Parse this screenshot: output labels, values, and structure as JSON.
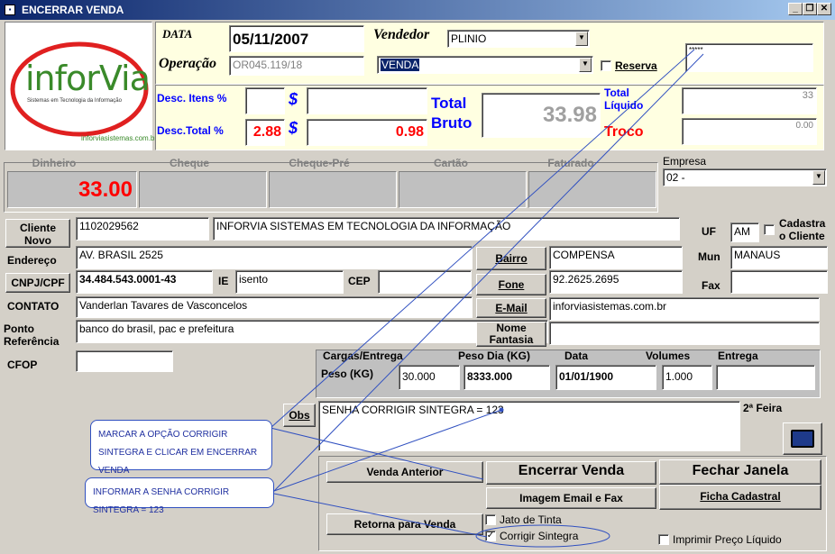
{
  "window": {
    "title": "ENCERRAR VENDA",
    "min": "_",
    "max": "❐",
    "close": "✕"
  },
  "logo": {
    "brand": "inforVia",
    "tagline": "Sistemas em Tecnologia da Informação",
    "site": "inforviasistemas.com.br"
  },
  "header": {
    "data_label": "DATA",
    "data_value": "05/11/2007",
    "vendedor_label": "Vendedor",
    "vendedor_value": "PLINIO",
    "operacao_label": "Operação",
    "operacao_value": "OR045.119/18",
    "tipo_value": "VENDA",
    "reserva_label": "Reserva",
    "reserva_checked": false,
    "password_value": "*****"
  },
  "totals": {
    "desc_itens_label": "Desc. Itens %",
    "desc_total_label": "Desc.Total %",
    "desc_total_pct": "2.88",
    "desc_total_val": "0.98",
    "dollar": "$",
    "total_bruto_label": "Total Bruto",
    "total_bruto_value": "33.98",
    "total_liquido_label": "Total Líquido",
    "total_liquido_value": "33",
    "troco_label": "Troco",
    "troco_value": "0.00"
  },
  "payments": {
    "headers": [
      "Dinheiro",
      "Cheque",
      "Cheque-Pré",
      "Cartão",
      "Faturado"
    ],
    "dinheiro_value": "33.00"
  },
  "empresa": {
    "label": "Empresa",
    "value": "02 -"
  },
  "cliente": {
    "cliente_novo_label": "Cliente Novo",
    "codigo": "1102029562",
    "nome": "INFORVIA SISTEMAS EM TECNOLOGIA DA INFORMAÇÃO",
    "uf_label": "UF",
    "uf_value": "AM",
    "cadastra_label": "Cadastra o Cliente",
    "endereco_label": "Endereço",
    "endereco": "AV. BRASIL 2525",
    "bairro_label": "Bairro",
    "bairro": "COMPENSA",
    "mun_label": "Mun",
    "mun": "MANAUS",
    "cnpj_label": "CNPJ/CPF",
    "cnpj": "34.484.543.0001-43",
    "ie_label": "IE",
    "ie": "isento",
    "cep_label": "CEP",
    "cep": "",
    "fone_label": "Fone",
    "fone": "92.2625.2695",
    "fax_label": "Fax",
    "fax": "",
    "contato_label": "CONTATO",
    "contato": "Vanderlan Tavares de Vasconcelos",
    "email_label": "E-Mail",
    "email": "inforviasistemas.com.br",
    "ponto_label": "Ponto Referência",
    "ponto": "banco do brasil, pac e prefeitura",
    "nome_fantasia_label": "Nome Fantasia",
    "nome_fantasia": "",
    "cfop_label": "CFOP",
    "cfop": ""
  },
  "cargas": {
    "headers": [
      "Cargas/Entrega",
      "Peso Dia (KG)",
      "Data",
      "Volumes",
      "Entrega"
    ],
    "peso_label": "Peso (KG)",
    "peso": "30.000",
    "peso_dia": "8333.000",
    "data": "01/01/1900",
    "volumes": "1.000",
    "entrega": ""
  },
  "obs": {
    "button": "Obs",
    "value": "SENHA CORRIGIR SINTEGRA = 123",
    "dia": "2ª Feira"
  },
  "actions": {
    "venda_anterior": "Venda Anterior",
    "encerrar_venda": "Encerrar Venda",
    "fechar_janela": "Fechar Janela",
    "imagem_email_fax": "Imagem  Email e Fax",
    "ficha_cadastral": "Ficha Cadastral",
    "retorna_venda": "Retorna para Venda",
    "jato_tinta": "Jato de Tinta",
    "corrigir_sintegra": "Corrigir Sintegra",
    "imprimir_preco": "Imprimir Preço Líquido"
  },
  "notes": {
    "note1": "MARCAR A OPÇÃO CORRIGIR SINTEGRA E CLICAR EM ENCERRAR VENDA",
    "note2": "INFORMAR A SENHA CORRIGIR SINTEGRA = 123"
  }
}
